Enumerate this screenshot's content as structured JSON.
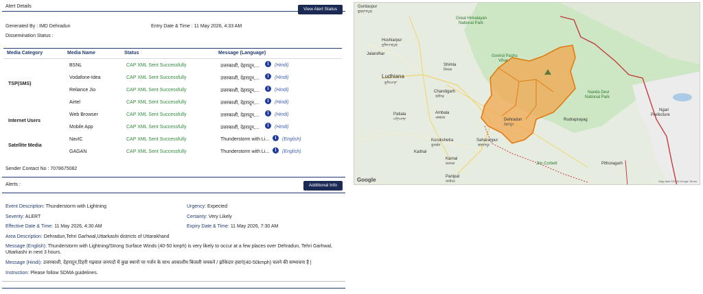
{
  "alert_details": {
    "title": "Alert Details",
    "view_status_button": "View Alert Status",
    "generated_by": "Generated By : IMD Dehradun",
    "entry_date": "Entry Date & Time : 11 May 2026, 4:33 AM",
    "dissemination_status": "Dissemination Status :"
  },
  "table": {
    "headers": [
      "Media Category",
      "Media Name",
      "Status",
      "Message (Language)"
    ],
    "categories": [
      "TSP(SMS)",
      "Internet Users",
      "Satellite Media"
    ],
    "rows": [
      {
        "name": "BSNL",
        "status": "CAP XML Sent Successfully",
        "message": "उत्तरकाशी, देहरादून,...",
        "lang": "(Hindi)"
      },
      {
        "name": "Vodafone-Idea",
        "status": "CAP XML Sent Successfully",
        "message": "उत्तरकाशी, देहरादून,...",
        "lang": "(Hindi)"
      },
      {
        "name": "Reliance Jio",
        "status": "CAP XML Sent Successfully",
        "message": "उत्तरकाशी, देहरादून,...",
        "lang": "(Hindi)"
      },
      {
        "name": "Airtel",
        "status": "CAP XML Sent Successfully",
        "message": "उत्तरकाशी, देहरादून,...",
        "lang": "(Hindi)"
      },
      {
        "name": "Web Browser",
        "status": "CAP XML Sent Successfully",
        "message": "उत्तरकाशी, देहरादून,...",
        "lang": "(Hindi)"
      },
      {
        "name": "Mobile App",
        "status": "CAP XML Sent Successfully",
        "message": "उत्तरकाशी, देहरादून,...",
        "lang": "(Hindi)"
      },
      {
        "name": "NavIC",
        "status": "CAP XML Sent Successfully",
        "message": "Thunderstorm with Li...",
        "lang": "(English)"
      },
      {
        "name": "GAGAN",
        "status": "CAP XML Sent Successfully",
        "message": "Thunderstorm with Li...",
        "lang": "(English)"
      }
    ],
    "info_glyph": "i"
  },
  "sender_contact": "Sender Contact No : 7078675082",
  "alerts": {
    "title": "Alerts :",
    "additional_info_button": "Additional Info",
    "event_label": "Event Description:",
    "event_value": "Thunderstorm with Lightning",
    "urgency_label": "Urgency:",
    "urgency_value": "Expected",
    "severity_label": "Severity:",
    "severity_value": "ALERT",
    "certainty_label": "Certainty:",
    "certainty_value": "Very Likely",
    "effective_label": "Effective Date & Time:",
    "effective_value": "11 May 2026, 4:30 AM",
    "expiry_label": "Expiry Date & Time:",
    "expiry_value": "11 May 2026, 7:30 AM",
    "area_label": "Area Description:",
    "area_value": "Dehradun,Tehri Garhwal,Uttarkashi districts of Uttarakhand",
    "msg_en_label": "Message (English):",
    "msg_en_line1": "Thunderstorm with Lightning/Strong Surface Winds (40-50 kmph) is very likely to occur at a few places over Dehradun, Tehri Garhwal,",
    "msg_en_line2": "Uttarkashi in next 3 hours.",
    "msg_hi_label": "Message (Hindi):",
    "msg_hi_value": "उत्तरकाशी, देहरादून,टिहरी गढ़वाल जनपदों में कुछ स्थानों पर गर्जन के साथ आकाशीय बिजली चमकने / झोंकेदार हवाएं(40-50kmph) चलने की सम्भावना है |",
    "instruction_label": "Instruction:",
    "instruction_value": "Please follow SDMA guidelines."
  },
  "map": {
    "labels": {
      "gurdaspur": "Gurdaspur",
      "gurdaspur_hi": "ਗੁਰਦਾਸਪੁਰ",
      "hoshiarpur": "Hoshiarpur",
      "hoshiarpur_hi": "ਹੁਸ਼ਿਆਰਪੁਰ",
      "jalandhar": "Jalandhar",
      "ludhiana": "Ludhiana",
      "ludhiana_hi": "ਲੁਧਿਆਣਾ",
      "shimla": "Shimla",
      "shimla_hi": "शिमला",
      "chandigarh": "Chandigarh",
      "chandigarh_hi": "चंडीगढ़",
      "patiala": "Patiala",
      "patiala_hi": "ਪਟਿਆਲਾ",
      "ambala": "Ambala",
      "ambala_hi": "अम्बाला",
      "kurukshetra": "Kurukshetra",
      "kurukshetra_hi": "कुरुक्षेत्र",
      "saharanpur": "Saharanpur",
      "saharanpur_hi": "सहारनपुर",
      "karnal": "Karnal",
      "karnal_hi": "करनाल",
      "kaithal": "Kaithal",
      "panipat": "Panipat",
      "panipat_hi": "पानीपत",
      "dehradun": "Dehradun",
      "dehradun_hi": "देहरादून",
      "nanda_devi": "Nanda Devi",
      "national_park": "National Park",
      "ngari": "Ngari",
      "prefecture": "Prefecture",
      "great_himalayan": "Great Himalayan",
      "national_park2": "National Park",
      "govind_pashu": "Govind Pashu",
      "vihar": "Vihar",
      "rudraprayag": "Rudraprayag",
      "jim_corbett": "Jim Corbett",
      "pithoragarh": "Pithoragarh"
    },
    "google": "Google",
    "attribution": "Map data ©2026 Google   Terms",
    "colors": {
      "alert_fill": "#f3a54a",
      "alert_stroke": "#e07b12",
      "border": "#c43b3b",
      "terrain": "#cde6c4",
      "plain": "#e6ece0",
      "water": "#a9cbe6"
    }
  }
}
